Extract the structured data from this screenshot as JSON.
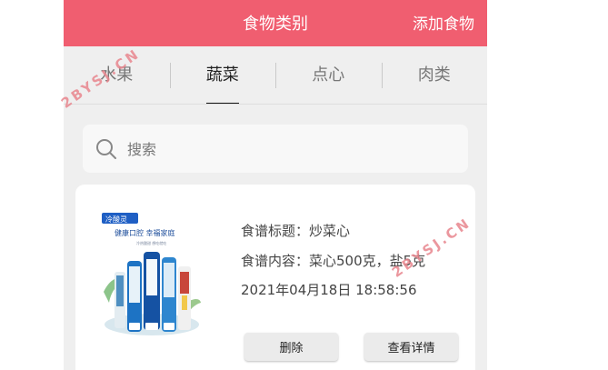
{
  "header": {
    "title": "食物类别",
    "add_label": "添加食物"
  },
  "tabs": [
    {
      "label": "水果",
      "active": false
    },
    {
      "label": "蔬菜",
      "active": true
    },
    {
      "label": "点心",
      "active": false
    },
    {
      "label": "肉类",
      "active": false
    }
  ],
  "search": {
    "placeholder": "搜索",
    "value": ""
  },
  "recipe": {
    "title_line": "食谱标题：炒菜心",
    "content_line": "食谱内容：菜心500克，盐5克",
    "datetime": "2021年04月18日 18:58:56",
    "delete_label": "删除",
    "details_label": "查看详情",
    "image": {
      "brand": "冷酸灵",
      "slogan": "健康口腔 幸福家庭",
      "subtext": "冷热酸甜 想吃就吃"
    }
  },
  "watermark": "2BYSJ.CN",
  "colors": {
    "header_bg": "#f05e70",
    "page_bg": "#efefef",
    "card_bg": "#ffffff",
    "watermark": "#e8868e"
  }
}
